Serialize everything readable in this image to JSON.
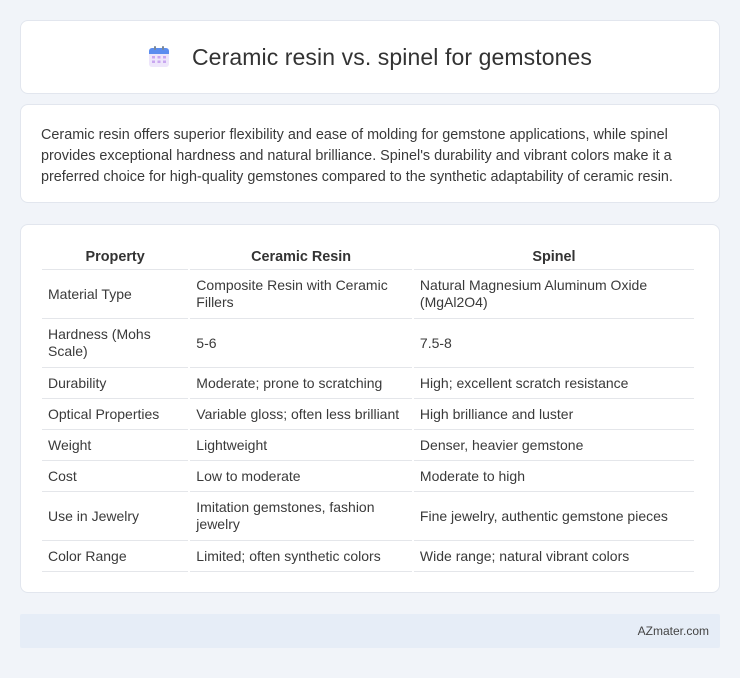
{
  "header": {
    "title": "Ceramic resin vs. spinel for gemstones",
    "icon": "calendar-icon",
    "icon_colors": {
      "top": "#5b8def",
      "grid": "#c9a7f0"
    }
  },
  "summary": {
    "text": "Ceramic resin offers superior flexibility and ease of molding for gemstone applications, while spinel provides exceptional hardness and natural brilliance. Spinel's durability and vibrant colors make it a preferred choice for high-quality gemstones compared to the synthetic adaptability of ceramic resin."
  },
  "table": {
    "headers": [
      "Property",
      "Ceramic Resin",
      "Spinel"
    ],
    "rows": [
      [
        "Material Type",
        "Composite Resin with Ceramic Fillers",
        "Natural Magnesium Aluminum Oxide (MgAl2O4)"
      ],
      [
        "Hardness (Mohs Scale)",
        "5-6",
        "7.5-8"
      ],
      [
        "Durability",
        "Moderate; prone to scratching",
        "High; excellent scratch resistance"
      ],
      [
        "Optical Properties",
        "Variable gloss; often less brilliant",
        "High brilliance and luster"
      ],
      [
        "Weight",
        "Lightweight",
        "Denser, heavier gemstone"
      ],
      [
        "Cost",
        "Low to moderate",
        "Moderate to high"
      ],
      [
        "Use in Jewelry",
        "Imitation gemstones, fashion jewelry",
        "Fine jewelry, authentic gemstone pieces"
      ],
      [
        "Color Range",
        "Limited; often synthetic colors",
        "Wide range; natural vibrant colors"
      ]
    ]
  },
  "footer": {
    "brand": "AZmater.com"
  }
}
